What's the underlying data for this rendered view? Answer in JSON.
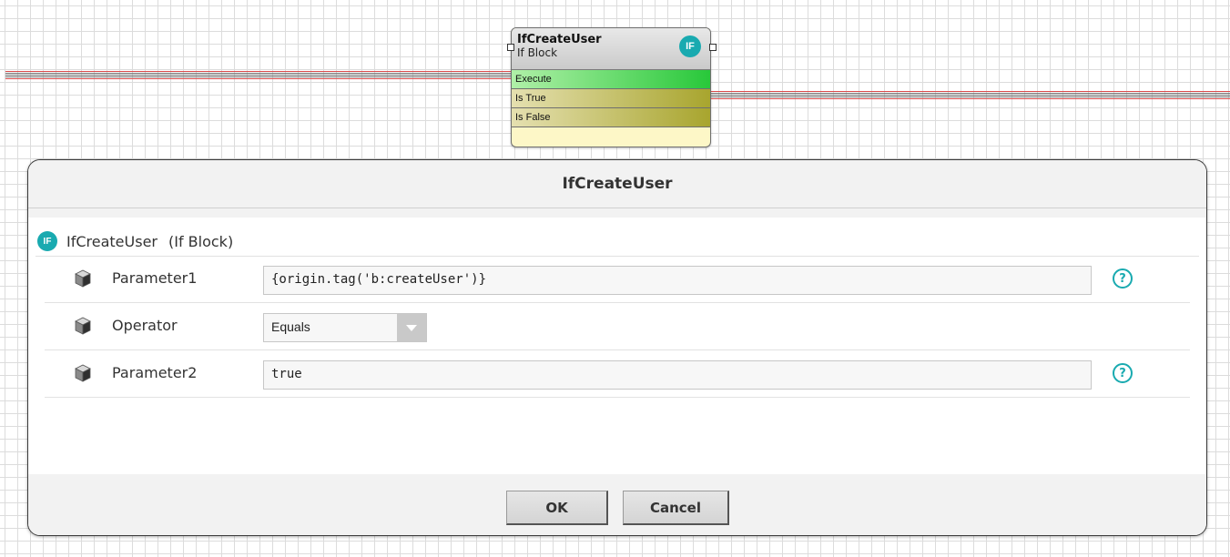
{
  "canvas": {
    "snap": {
      "title": "IfCreateUser",
      "subtitle": "If Block",
      "icon_label": "IF",
      "rows": [
        "Execute",
        "Is True",
        "Is False"
      ]
    }
  },
  "dialog": {
    "title": "IfCreateUser",
    "header": {
      "icon_label": "IF",
      "name": "IfCreateUser",
      "type": "(If Block)"
    },
    "properties": [
      {
        "label": "Parameter1",
        "value": "{origin.tag('b:createUser')}",
        "kind": "text",
        "help": "?"
      },
      {
        "label": "Operator",
        "value": "Equals",
        "kind": "select"
      },
      {
        "label": "Parameter2",
        "value": "true",
        "kind": "text",
        "help": "?"
      }
    ],
    "buttons": {
      "ok": "OK",
      "cancel": "Cancel"
    }
  },
  "colors": {
    "accent_teal": "#19aab0",
    "execute_green": "#28c83a",
    "view_olive": "#a8a52e",
    "wire_red": "#d84a4a",
    "wire_gray": "#6e6e6e"
  },
  "icons": {
    "snap_icon": "if-icon",
    "property_icon": "cube-icon",
    "help_icon": "question-circle-icon",
    "select_arrow": "chevron-down-icon"
  }
}
